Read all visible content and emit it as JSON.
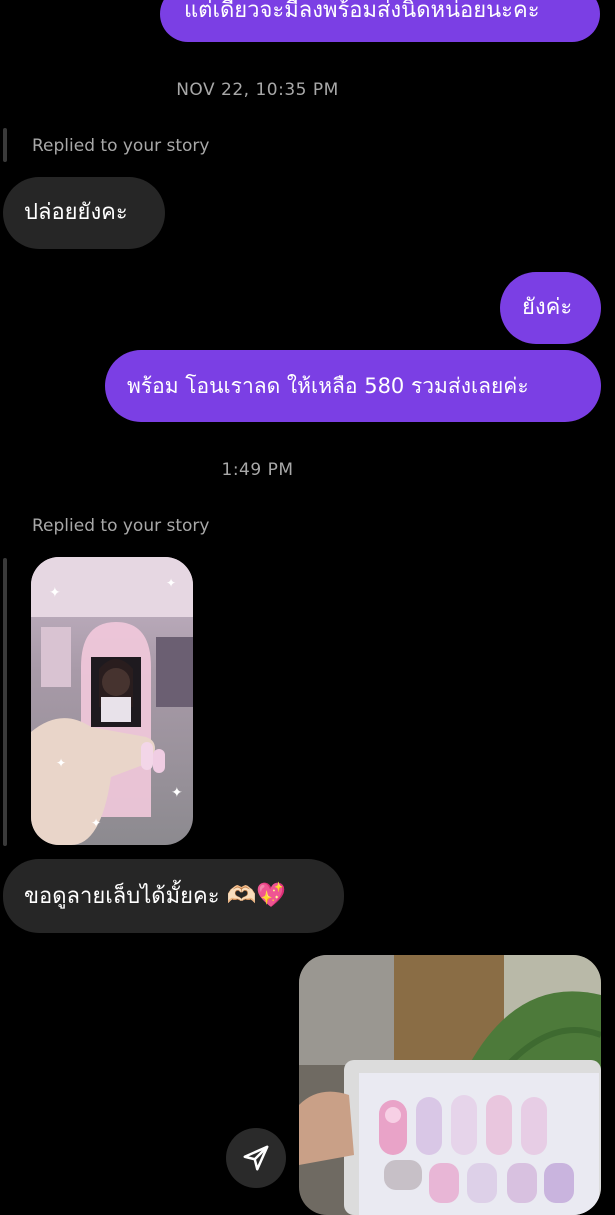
{
  "messages": {
    "top_cut_outgoing": "แต่เดี๋ยวจะมีลงพร้อมส่งนิดหน่อยนะคะ",
    "timestamp_1": "NOV 22, 10:35 PM",
    "reply_label_1": "Replied to your story",
    "incoming_1": "ปล่อยยังคะ",
    "outgoing_1": "ยังค่ะ",
    "outgoing_2": "พร้อม โอนเราลด ให้เหลือ 580 รวมส่งเลยค่ะ",
    "timestamp_2": "1:49 PM",
    "reply_label_2": "Replied to your story",
    "incoming_2": "ขอดูลายเล็บได้มั้ยคะ",
    "incoming_2_emoji": "🫶🏻💖"
  },
  "colors": {
    "background": "#000000",
    "outgoing_bubble": "#7b3fe4",
    "incoming_bubble": "#262626",
    "muted_text": "#a8a8a8"
  },
  "icons": {
    "send": "paper-plane-icon"
  }
}
